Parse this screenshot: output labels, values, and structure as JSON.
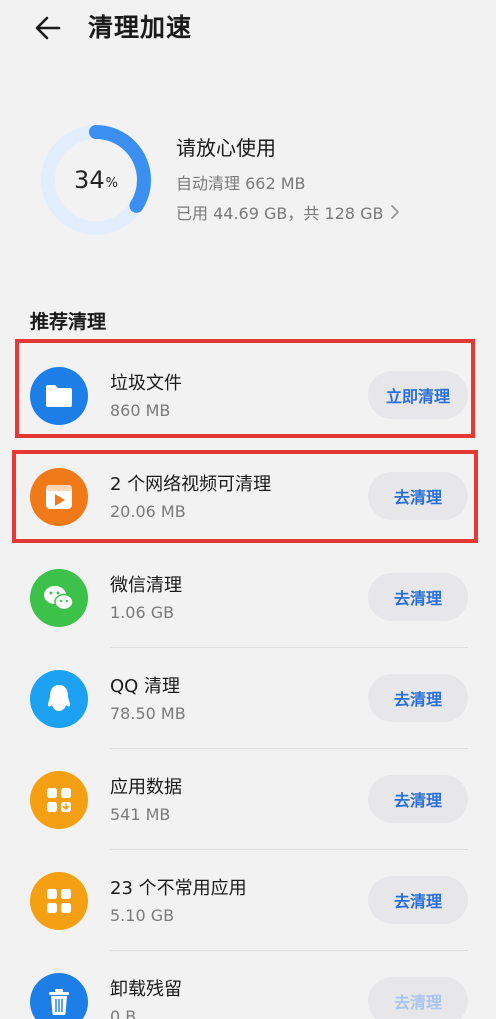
{
  "header": {
    "title": "清理加速"
  },
  "storage": {
    "percent_value": "34",
    "percent_unit": "%",
    "used_fraction": 0.34,
    "status": "请放心使用",
    "auto_clean": "自动清理 662 MB",
    "usage": "已用 44.69 GB，共 128 GB"
  },
  "section": {
    "title": "推荐清理"
  },
  "items": [
    {
      "name": "垃圾文件",
      "size": "860 MB",
      "button": "立即清理",
      "icon": "folder-icon",
      "color": "#1e7ee8"
    },
    {
      "name": "2 个网络视频可清理",
      "size": "20.06 MB",
      "button": "去清理",
      "icon": "video-icon",
      "color": "#f07a18"
    },
    {
      "name": "微信清理",
      "size": "1.06 GB",
      "button": "去清理",
      "icon": "wechat-icon",
      "color": "#3cc24a"
    },
    {
      "name": "QQ 清理",
      "size": "78.50 MB",
      "button": "去清理",
      "icon": "qq-icon",
      "color": "#1da1f2"
    },
    {
      "name": "应用数据",
      "size": "541 MB",
      "button": "去清理",
      "icon": "app-data-icon",
      "color": "#f5a012"
    },
    {
      "name": "23 个不常用应用",
      "size": "5.10 GB",
      "button": "去清理",
      "icon": "apps-grid-icon",
      "color": "#f5a012"
    },
    {
      "name": "卸载残留",
      "size": "0 B",
      "button": "去清理",
      "icon": "trash-icon",
      "color": "#1e7ee8"
    }
  ],
  "colors": {
    "accent": "#2a6fd8",
    "ring_track": "#e3eefc",
    "ring_fill": "#3a8ff0",
    "highlight": "#e53935"
  }
}
